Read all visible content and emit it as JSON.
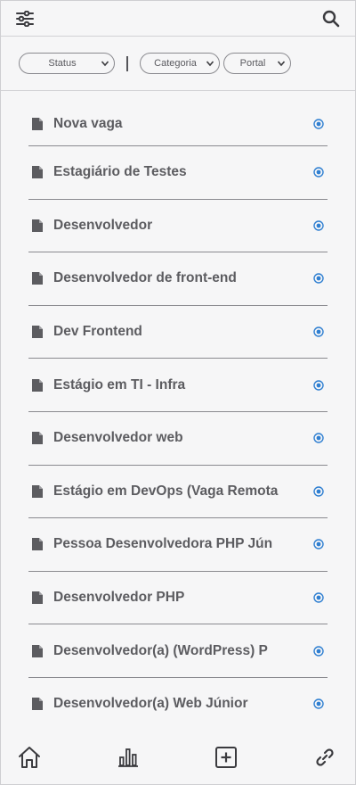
{
  "header": {
    "filter_icon": "sliders-icon",
    "search_icon": "search-icon"
  },
  "filters": {
    "status": "Status",
    "categoria": "Categoria",
    "portal": "Portal"
  },
  "items": [
    {
      "title": "Nova vaga"
    },
    {
      "title": "Estagiário de Testes"
    },
    {
      "title": "Desenvolvedor"
    },
    {
      "title": "Desenvolvedor de front-end"
    },
    {
      "title": "Dev Frontend"
    },
    {
      "title": "Estágio em TI - Infra"
    },
    {
      "title": "Desenvolvedor web"
    },
    {
      "title": "Estágio em DevOps (Vaga Remota"
    },
    {
      "title": "Pessoa Desenvolvedora PHP Jún"
    },
    {
      "title": "Desenvolvedor PHP"
    },
    {
      "title": "Desenvolvedor(a) (WordPress) P"
    },
    {
      "title": "Desenvolvedor(a) Web Júnior"
    }
  ],
  "bottom_nav": [
    "home-icon",
    "bar-chart-icon",
    "add-square-icon",
    "link-icon"
  ],
  "colors": {
    "text": "#5c5c60",
    "accent": "#2f7fd1",
    "background": "#f6f6f7"
  }
}
